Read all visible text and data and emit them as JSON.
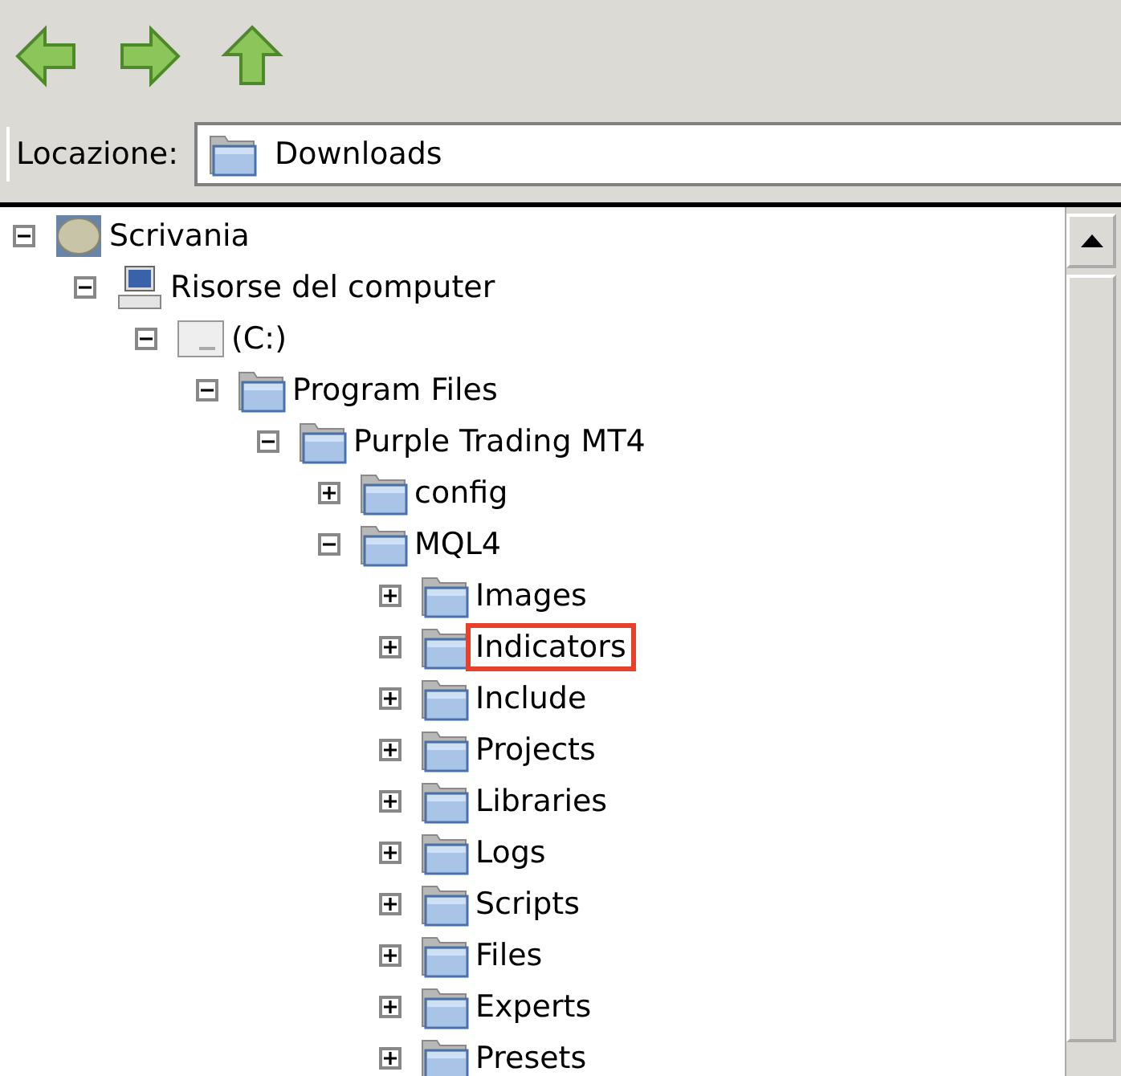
{
  "toolbar": {
    "buttons": [
      {
        "kind": "back"
      },
      {
        "kind": "forward"
      },
      {
        "kind": "up"
      }
    ]
  },
  "location": {
    "label": "Locazione:",
    "value": "Downloads"
  },
  "tree": [
    {
      "label": "Scrivania",
      "kind": "desktop",
      "expanded": true,
      "children": [
        {
          "label": "Risorse del computer",
          "kind": "computer",
          "expanded": true,
          "children": [
            {
              "label": "(C:)",
              "kind": "drive",
              "expanded": true,
              "children": [
                {
                  "label": "Program Files",
                  "kind": "folder",
                  "expanded": true,
                  "children": [
                    {
                      "label": "Purple Trading MT4",
                      "kind": "folder",
                      "expanded": true,
                      "children": [
                        {
                          "label": "config",
                          "kind": "folder",
                          "expanded": false,
                          "highlighted": false
                        },
                        {
                          "label": "MQL4",
                          "kind": "folder",
                          "expanded": true,
                          "children": [
                            {
                              "label": "Images",
                              "kind": "folder",
                              "expanded": false,
                              "highlighted": false
                            },
                            {
                              "label": "Indicators",
                              "kind": "folder",
                              "expanded": false,
                              "highlighted": true
                            },
                            {
                              "label": "Include",
                              "kind": "folder",
                              "expanded": false,
                              "highlighted": false
                            },
                            {
                              "label": "Projects",
                              "kind": "folder",
                              "expanded": false,
                              "highlighted": false
                            },
                            {
                              "label": "Libraries",
                              "kind": "folder",
                              "expanded": false,
                              "highlighted": false
                            },
                            {
                              "label": "Logs",
                              "kind": "folder",
                              "expanded": false,
                              "highlighted": false
                            },
                            {
                              "label": "Scripts",
                              "kind": "folder",
                              "expanded": false,
                              "highlighted": false
                            },
                            {
                              "label": "Files",
                              "kind": "folder",
                              "expanded": false,
                              "highlighted": false
                            },
                            {
                              "label": "Experts",
                              "kind": "folder",
                              "expanded": false,
                              "highlighted": false
                            },
                            {
                              "label": "Presets",
                              "kind": "folder",
                              "expanded": false,
                              "highlighted": false
                            }
                          ]
                        }
                      ]
                    }
                  ]
                }
              ]
            }
          ]
        }
      ]
    }
  ]
}
